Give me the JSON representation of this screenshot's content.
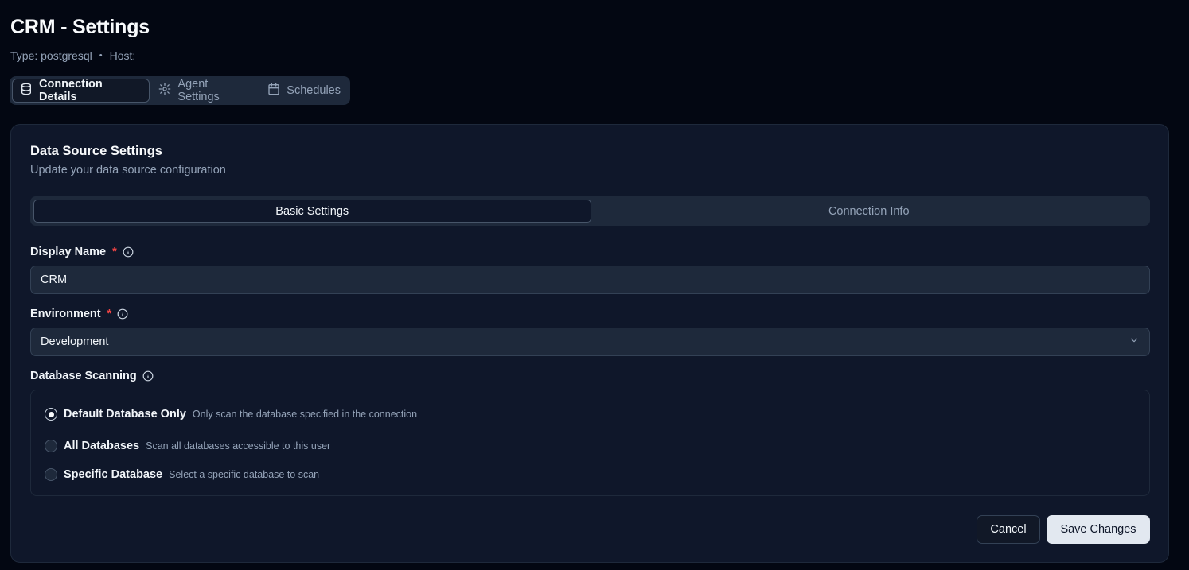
{
  "header": {
    "title": "CRM - Settings",
    "type_label": "Type: postgresql",
    "separator": "•",
    "host_label": "Host:"
  },
  "top_tabs": [
    {
      "label": "Connection Details",
      "icon": "database-icon",
      "active": true
    },
    {
      "label": "Agent Settings",
      "icon": "gear-icon",
      "active": false
    },
    {
      "label": "Schedules",
      "icon": "calendar-icon",
      "active": false
    }
  ],
  "card": {
    "title": "Data Source Settings",
    "description": "Update your data source configuration"
  },
  "inner_tabs": [
    {
      "label": "Basic Settings",
      "active": true
    },
    {
      "label": "Connection Info",
      "active": false
    }
  ],
  "form": {
    "display_name": {
      "label": "Display Name",
      "required_mark": "*",
      "value": "CRM"
    },
    "environment": {
      "label": "Environment",
      "required_mark": "*",
      "value": "Development"
    },
    "database_scanning": {
      "label": "Database Scanning",
      "options": [
        {
          "label": "Default Database Only",
          "description": "Only scan the database specified in the connection",
          "checked": true
        },
        {
          "label": "All Databases",
          "description": "Scan all databases accessible to this user",
          "checked": false
        },
        {
          "label": "Specific Database",
          "description": "Select a specific database to scan",
          "checked": false
        }
      ]
    }
  },
  "actions": {
    "cancel_label": "Cancel",
    "save_label": "Save Changes"
  },
  "colors": {
    "background": "#030712",
    "card": "#0f172a",
    "required": "#ef4444",
    "primary_button": "#e2e8f0"
  }
}
